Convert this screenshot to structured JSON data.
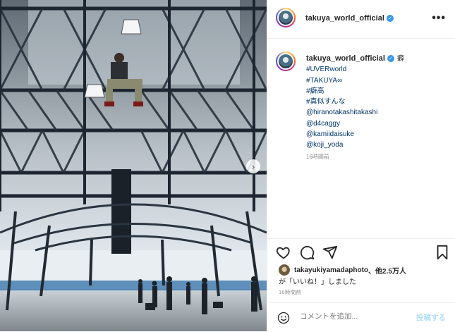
{
  "post": {
    "username": "takuya_world_official",
    "verified_mark": "✓",
    "more_label": "•••",
    "carousel_next": "›",
    "caption": {
      "first_word": "癖",
      "lines": [
        "#UVERworld",
        "#TAKUYA∞",
        "#癖高",
        "#真似すんな",
        "@hiranotakashitakashi",
        "@d4caggy",
        "@kamiidaisuke",
        "@koji_yoda"
      ],
      "time": "16時間前"
    },
    "likes": {
      "liker": "takayukiyamadaphoto",
      "suffix": "、他2.5万人",
      "line2": "が「いいね！」しました"
    },
    "timestamp": "16時間前",
    "comment": {
      "placeholder": "コメントを追加...",
      "post_label": "投稿する"
    }
  },
  "icons": {
    "heart": "heart-icon",
    "comment": "comment-icon",
    "share": "paper-plane-icon",
    "bookmark": "bookmark-icon",
    "emoji": "emoji-icon",
    "more": "more-icon"
  },
  "colors": {
    "link": "#00376b",
    "verified": "#3897f0",
    "muted": "#8e8e8e",
    "post_button": "#b2dffc",
    "border": "#dbdbdb"
  }
}
